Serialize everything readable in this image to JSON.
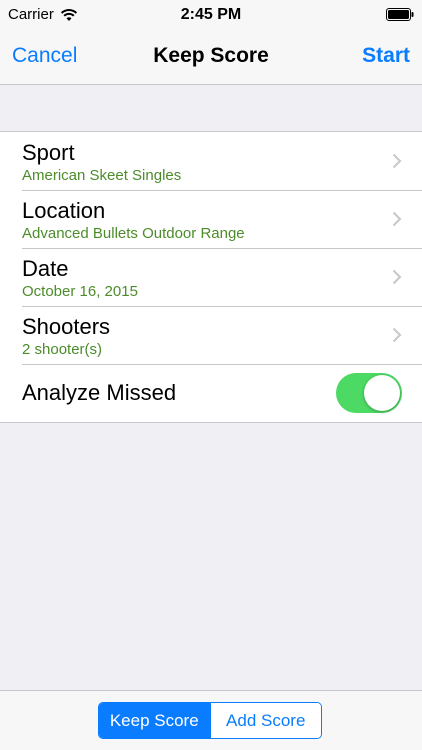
{
  "status_bar": {
    "carrier": "Carrier",
    "time": "2:45 PM"
  },
  "nav": {
    "cancel": "Cancel",
    "title": "Keep Score",
    "start": "Start"
  },
  "rows": [
    {
      "title": "Sport",
      "subtitle": "American Skeet Singles"
    },
    {
      "title": "Location",
      "subtitle": "Advanced Bullets Outdoor Range"
    },
    {
      "title": "Date",
      "subtitle": "October 16, 2015"
    },
    {
      "title": "Shooters",
      "subtitle": "2 shooter(s)"
    }
  ],
  "toggle_row": {
    "title": "Analyze Missed",
    "on": true
  },
  "segmented": {
    "items": [
      "Keep Score",
      "Add Score"
    ],
    "selected": 0
  },
  "colors": {
    "tint": "#0a7cff",
    "subtitle": "#4c8c2b",
    "toggle_on": "#4cd964"
  },
  "icons": [
    "wifi-icon",
    "battery-icon",
    "chevron-right-icon"
  ]
}
